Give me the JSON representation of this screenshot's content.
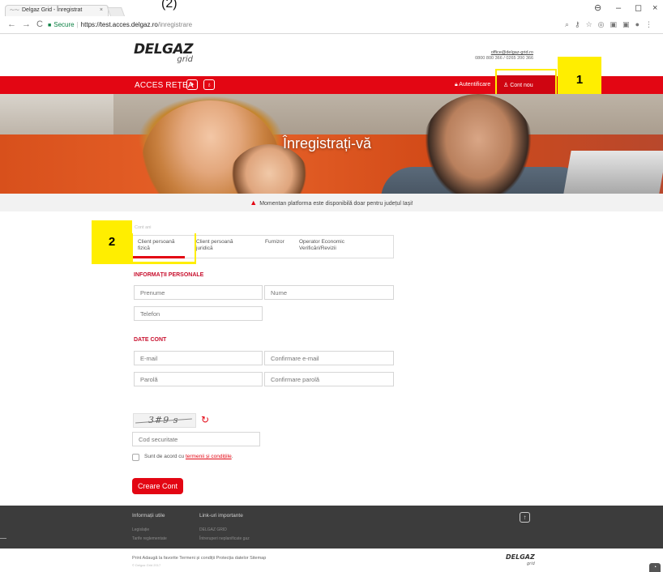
{
  "browser": {
    "tab_title": "Delgaz Grid - Înregistrat",
    "tab_close": "×",
    "annotation_top": "(2)",
    "secure_label": "Secure",
    "url_host": "https://test.acces.delgaz.ro",
    "url_path": "/inregistrare",
    "win_user": "⊖",
    "win_min": "–",
    "win_max": "◻",
    "win_close": "×"
  },
  "header": {
    "logo_main": "DELGAZ",
    "logo_sub": "grid",
    "contact_email": "office@delgaz-grid.ro",
    "contact_phone": "0800 800 366 / 0265 200 366"
  },
  "nav": {
    "brand": "ACCES REȚEA",
    "auth_label": "Autentificare",
    "new_account_label": "Cont nou"
  },
  "annotations": {
    "one": "1",
    "two": "2"
  },
  "hero": {
    "title": "Înregistrați-vă"
  },
  "notice": {
    "text": "Momentan platforma este disponibilă doar pentru județul Iași!"
  },
  "form": {
    "account_type_label": "Cont ani",
    "tabs": [
      {
        "label": "Client persoană fizică"
      },
      {
        "label": "Client persoană juridică"
      },
      {
        "label": "Furnizor"
      },
      {
        "label": "Operator Economic Verificări/Revizii"
      }
    ],
    "personal_section": "INFORMAȚII PERSONALE",
    "account_section": "DATE CONT",
    "placeholders": {
      "first_name": "Prenume",
      "last_name": "Nume",
      "phone": "Telefon",
      "email": "E-mail",
      "email_confirm": "Confirmare e-mail",
      "password": "Parolă",
      "password_confirm": "Confirmare parolă",
      "security_code": "Cod securitate"
    },
    "captcha_text": "3#9 s",
    "terms_prefix": "Sunt de acord cu",
    "terms_link": "termenii și condițiile",
    "terms_suffix": ".",
    "submit_label": "Creare Cont"
  },
  "footer": {
    "col1_title": "Informații utile",
    "col1_links": [
      "Legislație",
      "Tarife reglementate"
    ],
    "col2_title": "Link-uri importante",
    "col2_links": [
      "DELGAZ GRID",
      "Întreruperi neplanificate gaz"
    ],
    "bottom_links": "Print  Adaugă la favorite  Termeni și condiții  Protecția datelor  Sitemap",
    "copyright": "© Delgaz Grid 2017",
    "logo_main": "DELGAZ",
    "logo_sub": "grid"
  },
  "colors": {
    "brand_red": "#e30613",
    "annotation_yellow": "#ffee00",
    "footer_dark": "#3c3c3c"
  }
}
